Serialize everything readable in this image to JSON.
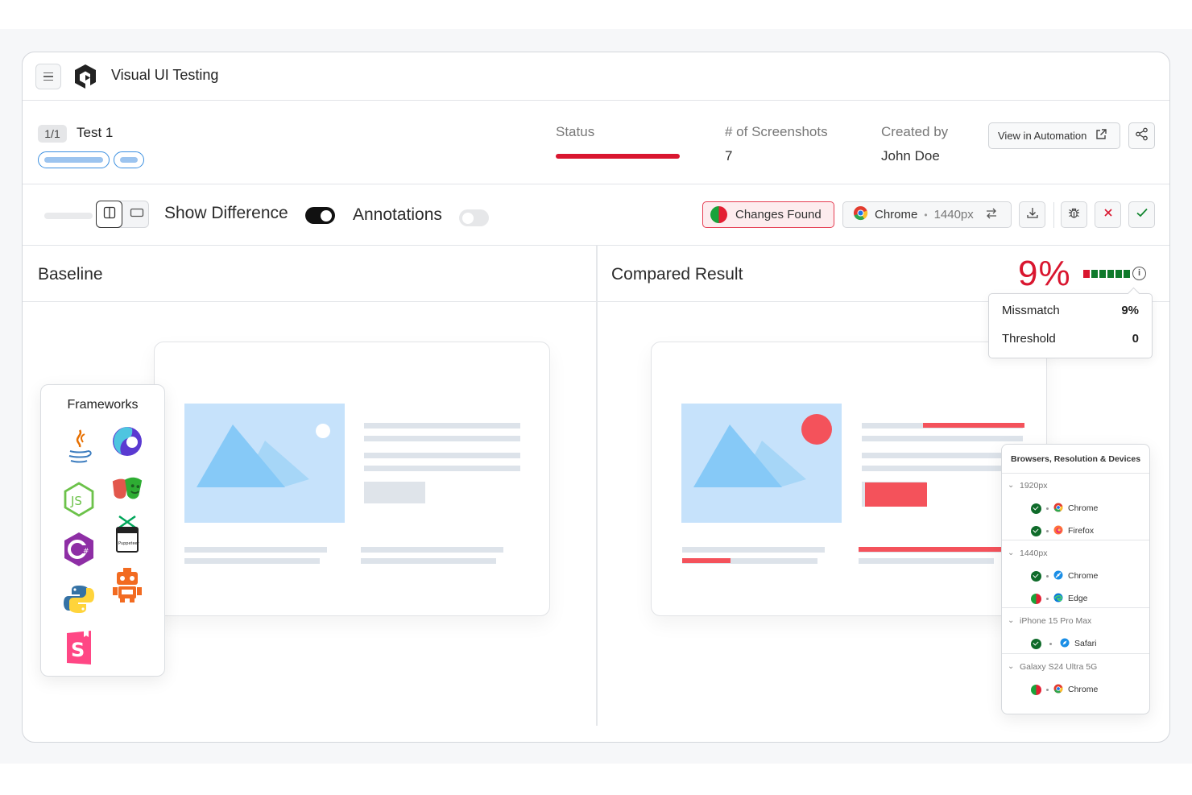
{
  "app": {
    "title": "Visual UI Testing"
  },
  "test": {
    "page": "1/1",
    "name": "Test 1",
    "status_label": "Status",
    "screenshots_label": "# of Screenshots",
    "screenshots_count": "7",
    "created_by_label": "Created by",
    "created_by": "John Doe",
    "view_in_automation": "View in Automation"
  },
  "toolbar": {
    "show_difference": "Show Difference",
    "show_difference_on": true,
    "annotations": "Annotations",
    "annotations_on": false,
    "changes_found": "Changes Found",
    "browser": "Chrome",
    "separator": "•",
    "resolution": "1440px"
  },
  "panels": {
    "baseline": "Baseline",
    "compared": "Compared Result",
    "mismatch_percent": "9%",
    "meter": {
      "filled_red": 1,
      "total": 6
    }
  },
  "tooltip": {
    "mismatch_label": "Missmatch",
    "mismatch_value": "9%",
    "threshold_label": "Threshold",
    "threshold_value": "0"
  },
  "frameworks": {
    "title": "Frameworks",
    "icons": [
      "java-icon",
      "cypress-icon",
      "nodejs-icon",
      "playwright-icon",
      "csharp-icon",
      "puppeteer-icon",
      "python-icon",
      "robot-icon",
      "storybook-icon"
    ],
    "puppeteer_text": "Puppeteer"
  },
  "devices": {
    "title": "Browsers, Resolution & Devices",
    "groups": [
      {
        "name": "1920px",
        "items": [
          {
            "browser": "Chrome",
            "status": "pass"
          },
          {
            "browser": "Firefox",
            "status": "pass"
          }
        ]
      },
      {
        "name": "1440px",
        "items": [
          {
            "browser": "Chrome",
            "status": "pass"
          },
          {
            "browser": "Edge",
            "status": "changed"
          }
        ]
      },
      {
        "name": "iPhone 15 Pro Max",
        "items": [
          {
            "browser": "Safari",
            "status": "pass"
          }
        ]
      },
      {
        "name": "Galaxy S24 Ultra 5G",
        "items": [
          {
            "browser": "Chrome",
            "status": "changed"
          }
        ]
      }
    ]
  },
  "colors": {
    "accent_red": "#d9162f",
    "pass_green": "#0f6b2a",
    "image_blue": "#c6e2fb",
    "mountain_blue": "#8ecdf8",
    "diff_red": "#f4525b"
  }
}
